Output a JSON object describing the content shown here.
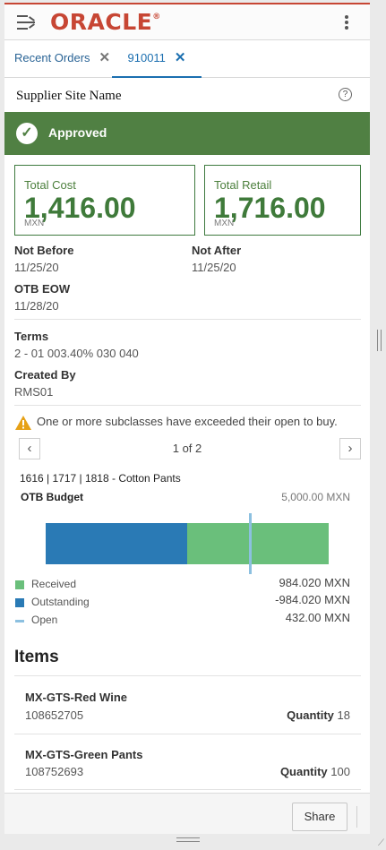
{
  "app": {
    "logo": "ORACLE",
    "logo_mark": "®"
  },
  "tabs": [
    {
      "label": "Recent Orders",
      "close": "✕"
    },
    {
      "label": "910011",
      "close": "✕"
    }
  ],
  "header": {
    "title": "Supplier Site Name",
    "help": "?"
  },
  "status": {
    "label": "Approved",
    "check": "✓"
  },
  "cost": {
    "total_cost_label": "Total Cost",
    "total_cost": "1,416.00",
    "total_cost_currency": "MXN",
    "total_retail_label": "Total Retail",
    "total_retail": "1,716.00",
    "total_retail_currency": "MXN"
  },
  "dates": {
    "not_before_label": "Not Before",
    "not_before": "11/25/20",
    "not_after_label": "Not After",
    "not_after": "11/25/20",
    "otb_eow_label": "OTB EOW",
    "otb_eow": "11/28/20"
  },
  "terms": {
    "label": "Terms",
    "value": "2 - 01 003.40% 030 040"
  },
  "created": {
    "label": "Created By",
    "value": "RMS01"
  },
  "warning": {
    "text": "One or more subclasses have exceeded their open to buy."
  },
  "pager": {
    "text": "1 of 2",
    "prev": "‹",
    "next": "›"
  },
  "otb": {
    "subclass": "1616 | 1717 | 1818  -  Cotton Pants",
    "title": "OTB Budget",
    "amount": "5,000.00 MXN",
    "legend": [
      {
        "label": "Received",
        "value": "984.020 MXN",
        "color": "#6abf7b"
      },
      {
        "label": "Outstanding",
        "value": "-984.020 MXN",
        "color": "#2a7ab5"
      },
      {
        "label": "Open",
        "value": "432.00 MXN",
        "color": "#8cc0e0"
      }
    ],
    "bar": {
      "outstanding_fraction": 0.5,
      "received_fraction": 0.5,
      "open_marker_fraction": 0.72
    }
  },
  "items": {
    "title": "Items",
    "list": [
      {
        "name": "MX-GTS-Red Wine",
        "code": "108652705",
        "qty_label": "Quantity",
        "qty": "18"
      },
      {
        "name": "MX-GTS-Green Pants",
        "code": "108752693",
        "qty_label": "Quantity",
        "qty": "100"
      }
    ]
  },
  "footer": {
    "share": "Share"
  },
  "colors": {
    "brand": "#c74634",
    "approved": "#508043",
    "link": "#1b6fb0"
  }
}
